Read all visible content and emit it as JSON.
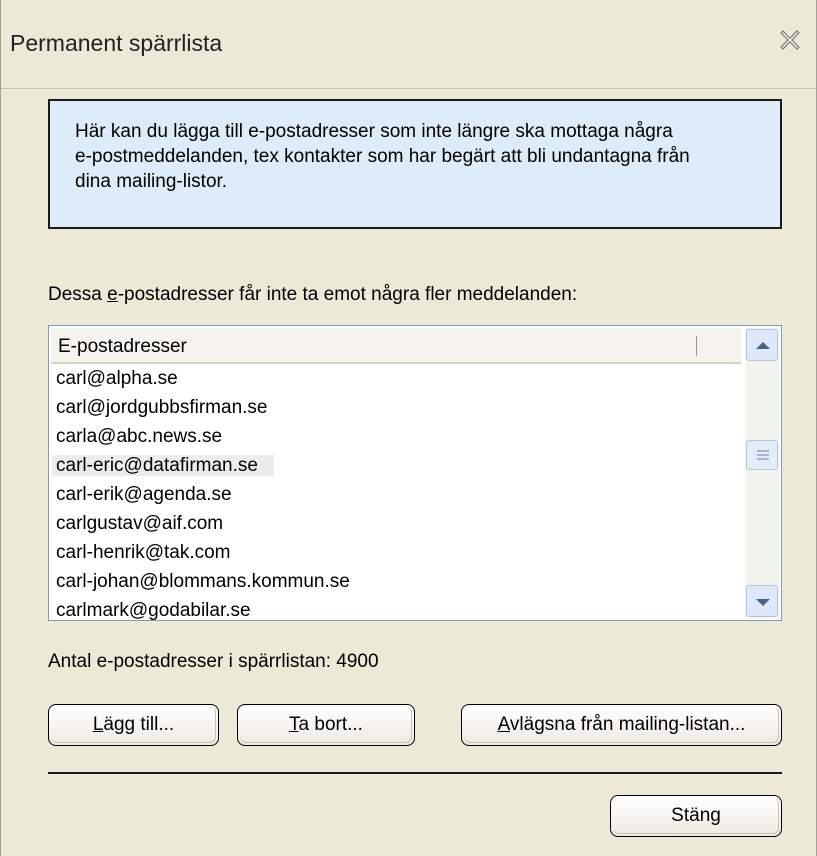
{
  "window": {
    "title": "Permanent spärrlista",
    "close_icon": "close-icon"
  },
  "info_box": {
    "lines": [
      "Här kan du lägga till e-postadresser som inte längre ska mottaga några",
      "e-postmeddelanden, tex kontakter som har begärt att bli undantagna från",
      "dina mailing-listor."
    ],
    "background": "#deebf8"
  },
  "list_label": {
    "before": "Dessa ",
    "accel": "e",
    "after": "-postadresser får inte ta emot några fler meddelanden:"
  },
  "email_list": {
    "column_header": "E-postadresser",
    "items": [
      "carl@alpha.se",
      "carl@jordgubbsfirman.se",
      "carla@abc.news.se",
      "carl-eric@datafirman.se",
      "carl-erik@agenda.se",
      "carlgustav@aif.com",
      "carl-henrik@tak.com",
      "carl-johan@blommans.kommun.se",
      "carlmark@godabilar.se"
    ],
    "highlighted_item": "carl-eric@datafirman.se"
  },
  "count_label": "Antal e-postadresser i spärrlistan: 4900",
  "buttons": {
    "add": {
      "accel": "L",
      "rest": "ägg till..."
    },
    "remove": {
      "accel": "T",
      "rest": "a bort..."
    },
    "remove_from_list": {
      "accel": "A",
      "rest": "vlägsna från mailing-listan..."
    },
    "close": "Stäng"
  },
  "colors": {
    "dialog_bg": "#ece9d8",
    "list_border": "#7f9db9",
    "scroll_accent": "#4d6185"
  }
}
